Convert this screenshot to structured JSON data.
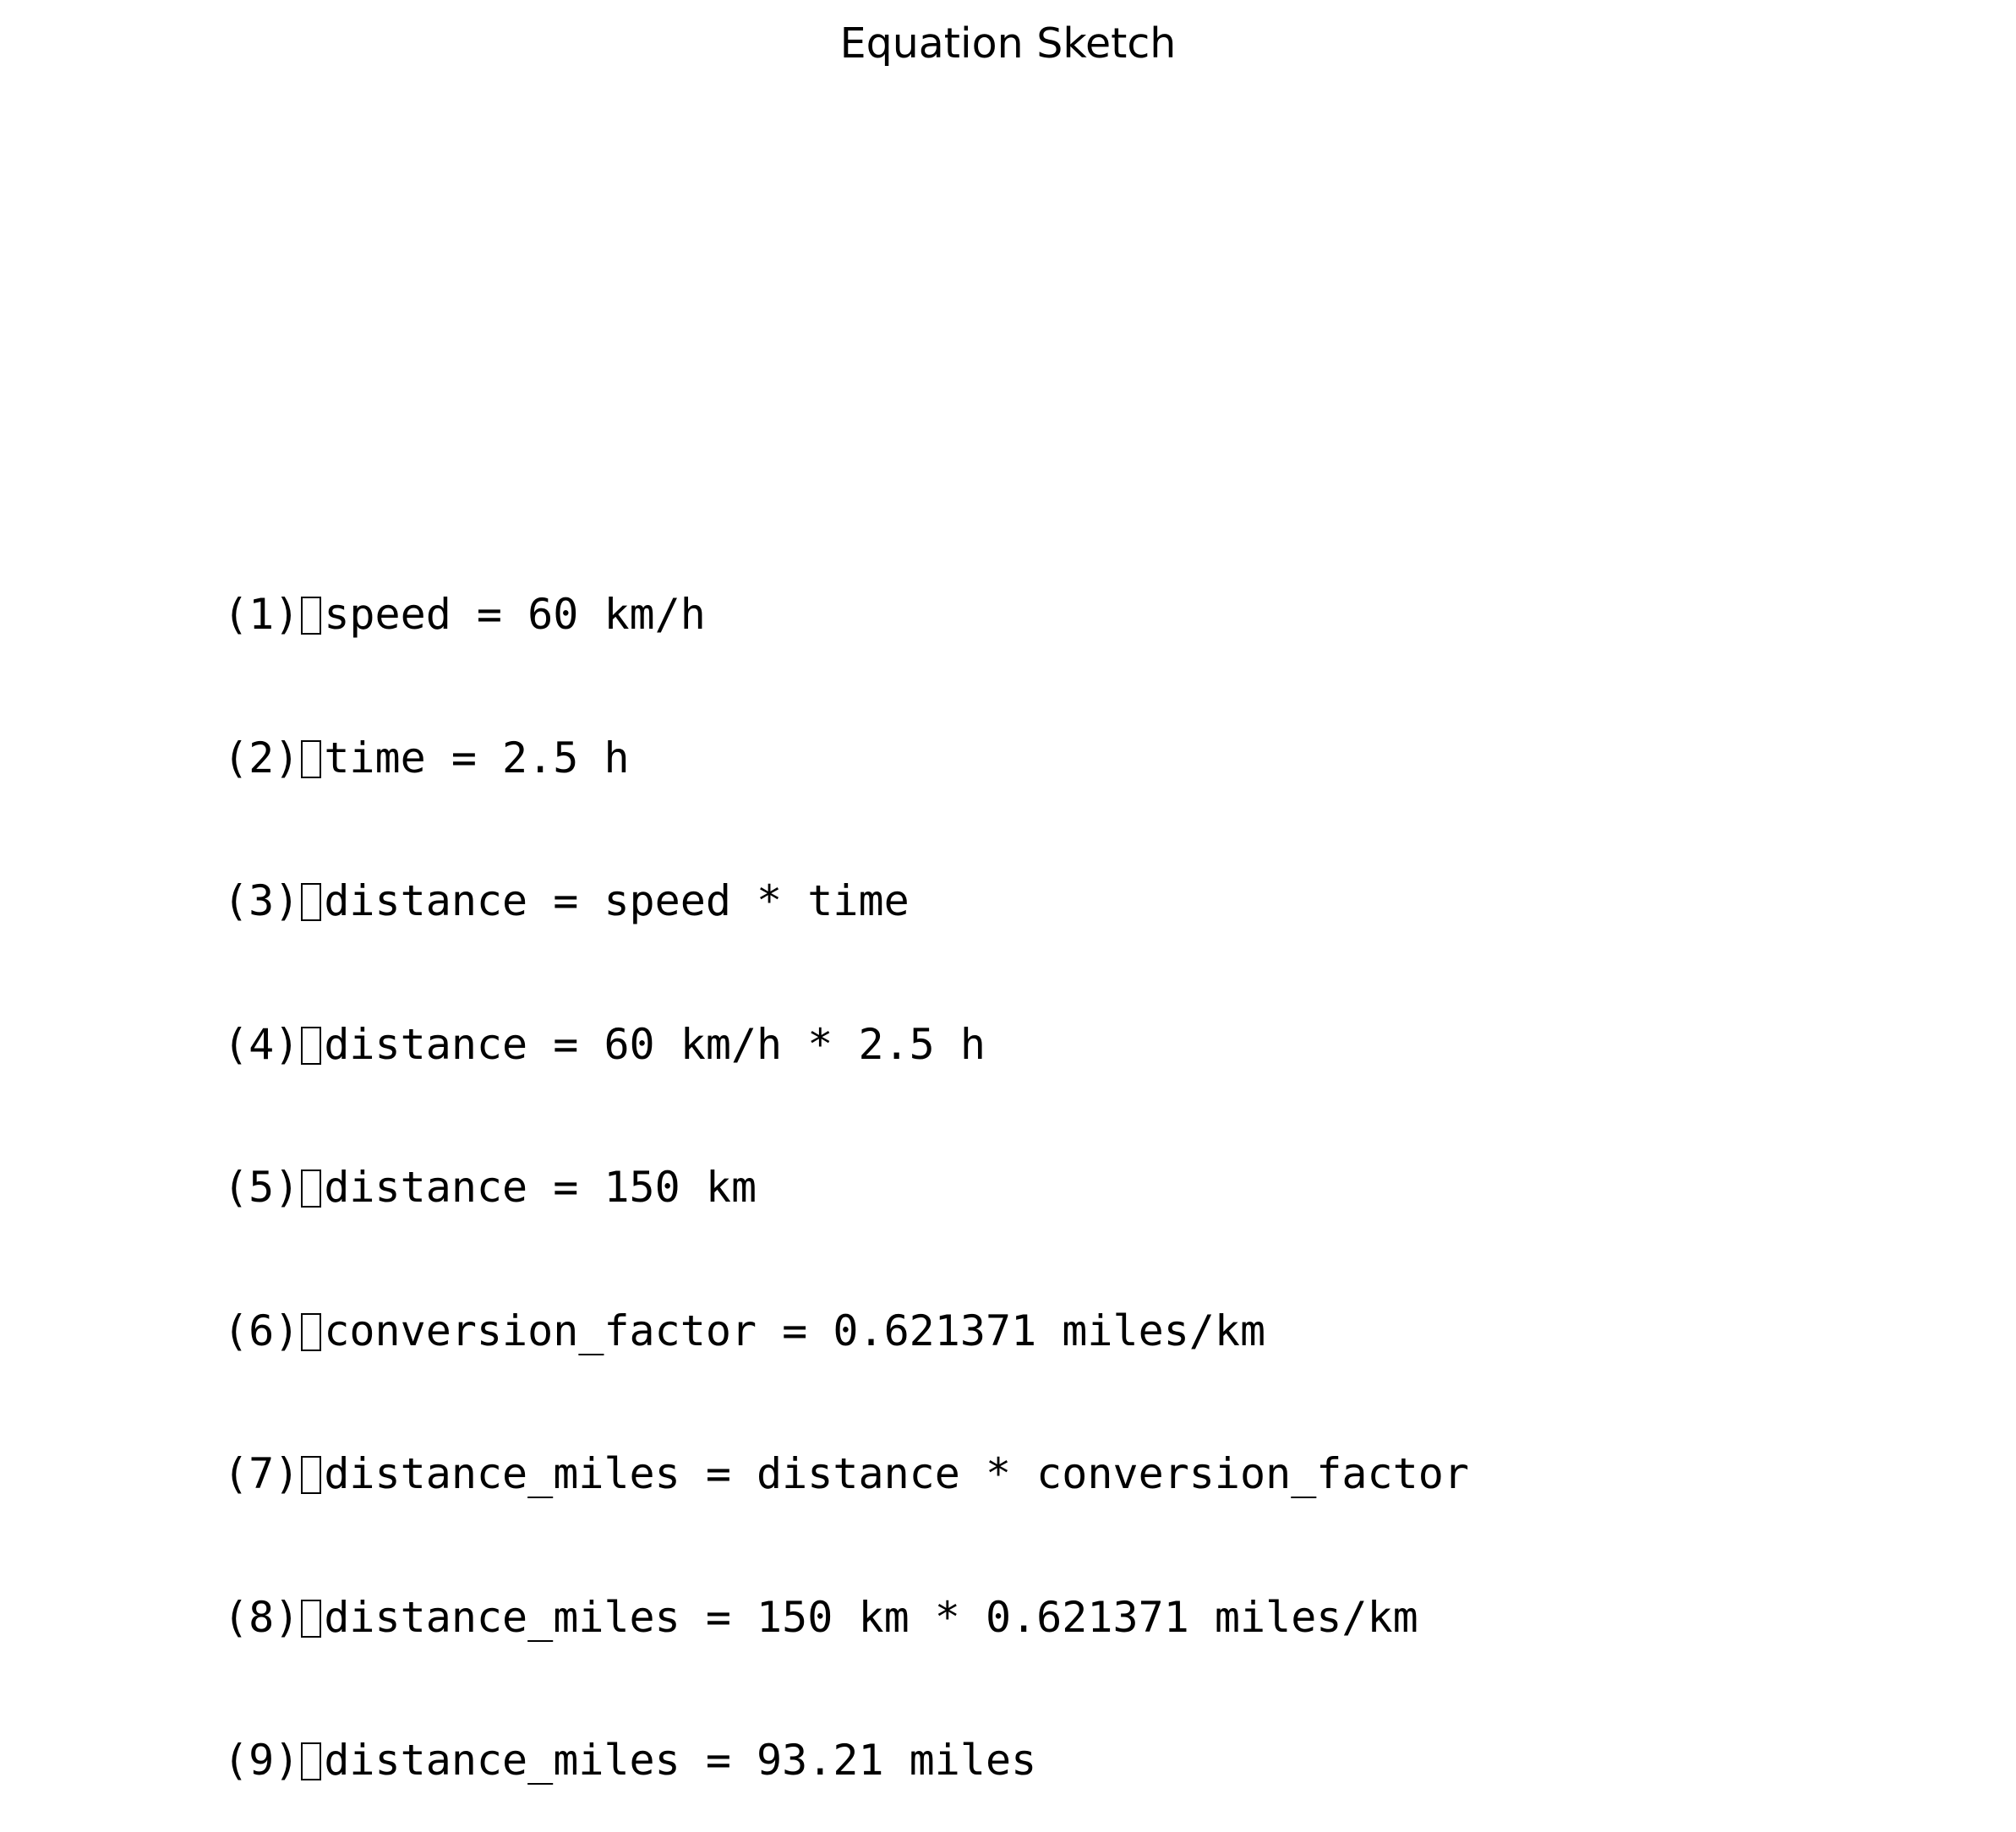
{
  "page": {
    "title": "Equation Sketch"
  },
  "equations": [
    {
      "number": "(1)",
      "expression": "speed = 60 km/h"
    },
    {
      "number": "(2)",
      "expression": "time = 2.5 h"
    },
    {
      "number": "(3)",
      "expression": "distance = speed * time"
    },
    {
      "number": "(4)",
      "expression": "distance = 60 km/h * 2.5 h"
    },
    {
      "number": "(5)",
      "expression": "distance = 150 km"
    },
    {
      "number": "(6)",
      "expression": "conversion_factor = 0.621371 miles/km"
    },
    {
      "number": "(7)",
      "expression": "distance_miles = distance * conversion_factor"
    },
    {
      "number": "(8)",
      "expression": "distance_miles = 150 km * 0.621371 miles/km"
    },
    {
      "number": "(9)",
      "expression": "distance_miles = 93.21 miles"
    }
  ]
}
